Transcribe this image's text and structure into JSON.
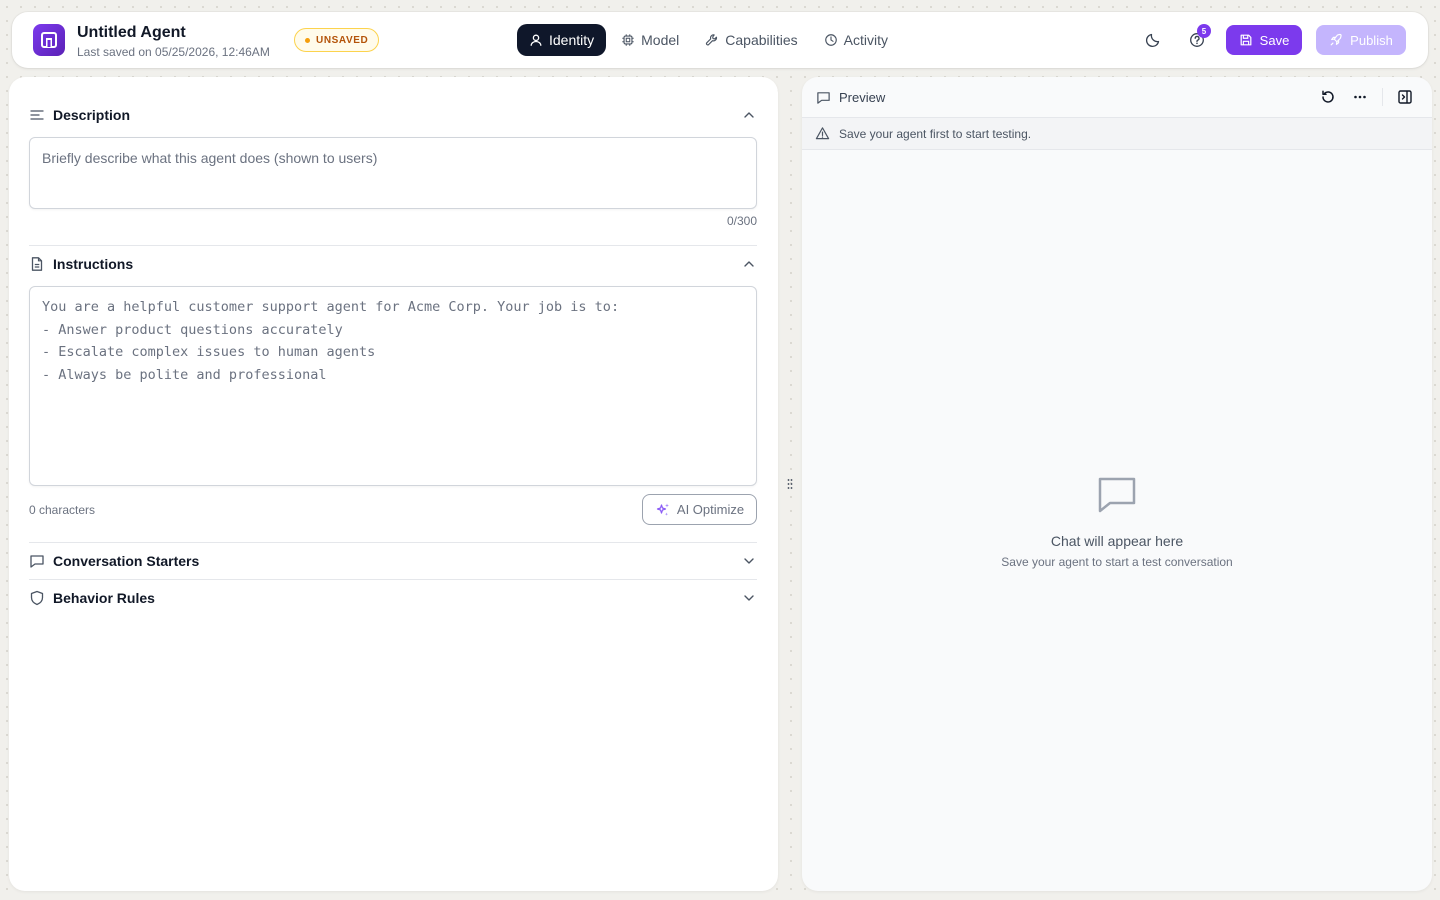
{
  "header": {
    "agent_name": "Untitled Agent",
    "last_saved": "Last saved on 05/25/2026, 12:46AM",
    "status_badge": "UNSAVED",
    "tabs": [
      {
        "label": "Identity",
        "icon": "user-icon",
        "active": true
      },
      {
        "label": "Model",
        "icon": "chip-icon",
        "active": false
      },
      {
        "label": "Capabilities",
        "icon": "wrench-icon",
        "active": false
      },
      {
        "label": "Activity",
        "icon": "clock-icon",
        "active": false
      }
    ],
    "help_badge_count": "5",
    "save_label": "Save",
    "publish_label": "Publish"
  },
  "editor": {
    "description": {
      "title": "Description",
      "placeholder": "Briefly describe what this agent does (shown to users)",
      "counter": "0/300"
    },
    "instructions": {
      "title": "Instructions",
      "text": "You are a helpful customer support agent for Acme Corp. Your job is to:\n- Answer product questions accurately\n- Escalate complex issues to human agents\n- Always be polite and professional",
      "char_count": "0 characters",
      "optimize_label": "AI Optimize"
    },
    "sections": [
      {
        "title": "Conversation Starters",
        "expanded": false
      },
      {
        "title": "Behavior Rules",
        "expanded": false
      }
    ]
  },
  "preview": {
    "title": "Preview",
    "warning": "Save your agent first to start testing.",
    "empty_title": "Chat will appear here",
    "empty_subtitle": "Save your agent to start a test conversation"
  },
  "colors": {
    "accent": "#7c3aed",
    "accent_disabled": "#c4b5fd",
    "active_tab": "#0f172a",
    "badge_warning": "#b45309"
  }
}
